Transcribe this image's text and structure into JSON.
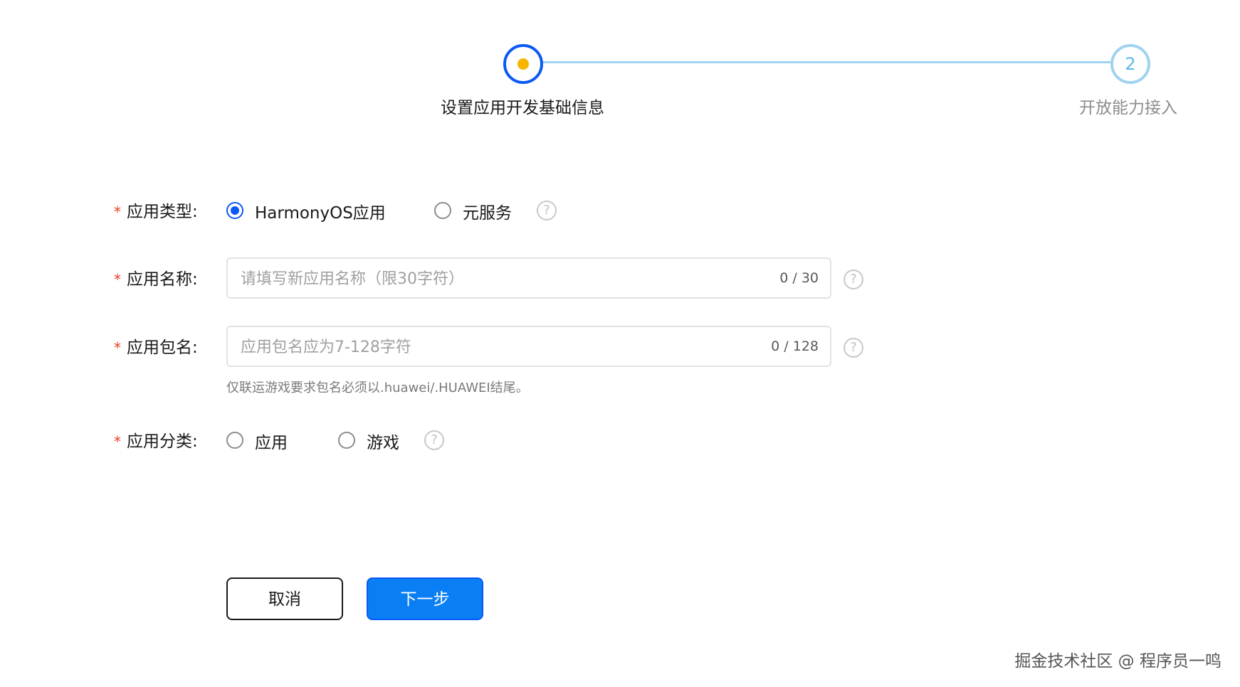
{
  "stepper": {
    "steps": [
      {
        "label": "设置应用开发基础信息",
        "number": "1",
        "state": "active"
      },
      {
        "label": "开放能力接入",
        "number": "2",
        "state": "pending"
      }
    ]
  },
  "form": {
    "app_type": {
      "required_mark": "*",
      "label": "应用类型:",
      "options": [
        {
          "label": "HarmonyOS应用",
          "selected": true
        },
        {
          "label": "元服务",
          "selected": false
        }
      ]
    },
    "app_name": {
      "required_mark": "*",
      "label": "应用名称:",
      "placeholder": "请填写新应用名称（限30字符）",
      "value": "",
      "counter": "0 / 30"
    },
    "package_name": {
      "required_mark": "*",
      "label": "应用包名:",
      "placeholder": "应用包名应为7-128字符",
      "value": "",
      "counter": "0 / 128",
      "hint": "仅联运游戏要求包名必须以.huawei/.HUAWEI结尾。"
    },
    "app_category": {
      "required_mark": "*",
      "label": "应用分类:",
      "options": [
        {
          "label": "应用",
          "selected": false
        },
        {
          "label": "游戏",
          "selected": false
        }
      ]
    }
  },
  "actions": {
    "cancel_label": "取消",
    "next_label": "下一步"
  },
  "help_icon_glyph": "?",
  "watermark": "掘金技术社区 @ 程序员一鸣",
  "colors": {
    "primary": "#0a59f7",
    "button_primary": "#0a7ff5",
    "step_line": "#9fd3f0",
    "step_dot": "#f7b500",
    "required": "#e84026"
  }
}
